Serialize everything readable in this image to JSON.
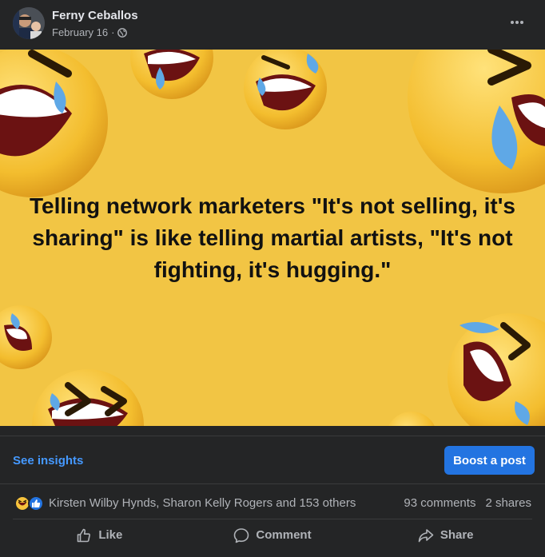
{
  "post": {
    "author": "Ferny Ceballos",
    "date": "February 16",
    "separator": "·",
    "privacy_icon": "globe-icon",
    "more_icon": "more-options-icon"
  },
  "image": {
    "quote": "Telling network marketers \"It's not selling, it's sharing\" is like telling martial artists, \"It's not fighting, it's hugging.\"",
    "background": "#f2c544"
  },
  "insights": {
    "see_insights": "See insights",
    "boost": "Boost a post"
  },
  "reactions": {
    "icons": [
      "haha-icon",
      "like-icon"
    ],
    "names": "Kirsten Wilby Hynds, Sharon Kelly Rogers and 153 others",
    "comments": "93 comments",
    "shares": "2 shares"
  },
  "actions": {
    "like": "Like",
    "comment": "Comment",
    "share": "Share"
  },
  "colors": {
    "accent": "#2374e1",
    "link": "#4599ff",
    "card": "#242526"
  }
}
